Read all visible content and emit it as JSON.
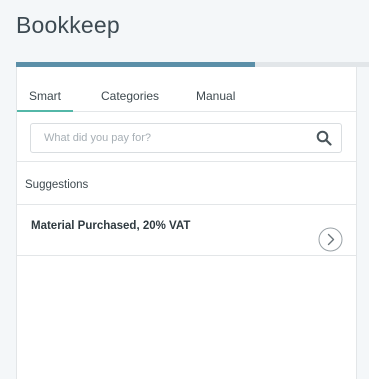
{
  "app": {
    "title": "Bookkeep"
  },
  "progress": {
    "fraction": 0.676
  },
  "tabs": [
    {
      "label": "Smart",
      "active": true
    },
    {
      "label": "Categories",
      "active": false
    },
    {
      "label": "Manual",
      "active": false
    }
  ],
  "search": {
    "placeholder": "What did you pay for?",
    "value": ""
  },
  "suggestions": {
    "header": "Suggestions",
    "items": [
      {
        "label": "Material Purchased, 20% VAT"
      }
    ]
  },
  "colors": {
    "progress_fill": "#5b8fa8",
    "tab_underline": "#53b7a8",
    "title_text": "#3d4a52"
  }
}
